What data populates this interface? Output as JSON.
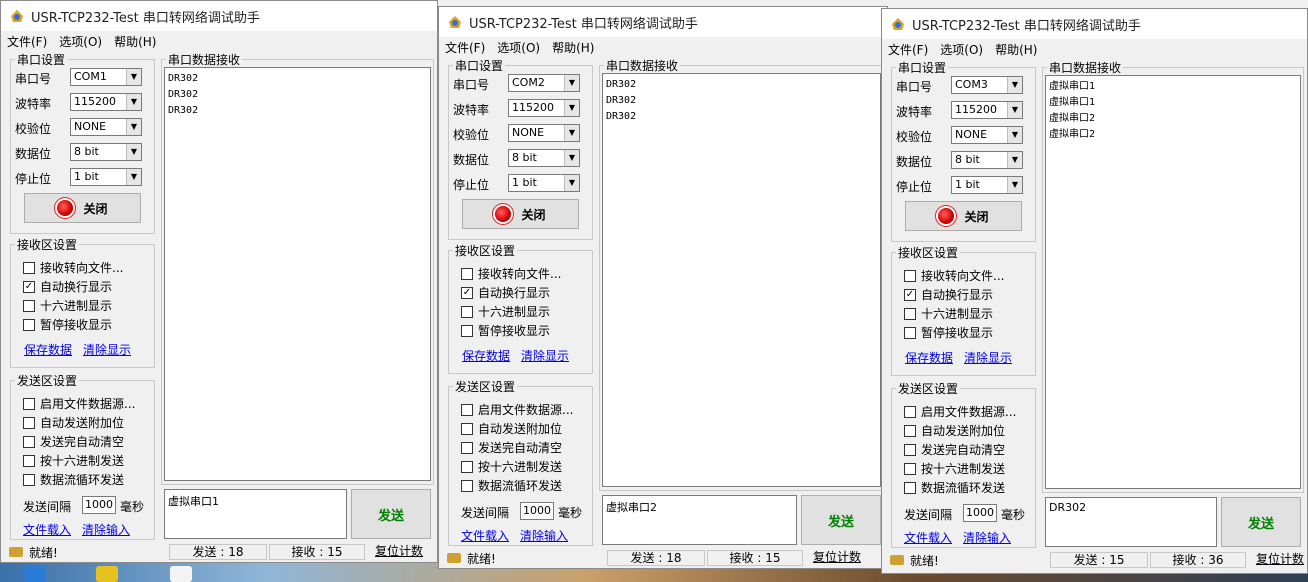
{
  "windows": [
    {
      "title": "USR-TCP232-Test 串口转网络调试助手",
      "menu": [
        "文件(F)",
        "选项(O)",
        "帮助(H)"
      ],
      "serial_group": "串口设置",
      "port_label": "串口号",
      "port": "COM1",
      "baud_label": "波特率",
      "baud": "115200",
      "parity_label": "校验位",
      "parity": "NONE",
      "databits_label": "数据位",
      "databits": "8 bit",
      "stopbits_label": "停止位",
      "stopbits": "1 bit",
      "close_label": "关闭",
      "recv_group": "接收区设置",
      "recv_opts": [
        {
          "label": "接收转向文件...",
          "checked": false
        },
        {
          "label": "自动换行显示",
          "checked": true
        },
        {
          "label": "十六进制显示",
          "checked": false
        },
        {
          "label": "暂停接收显示",
          "checked": false
        }
      ],
      "save_data": "保存数据",
      "clear_display": "清除显示",
      "send_group": "发送区设置",
      "send_opts": [
        {
          "label": "启用文件数据源...",
          "checked": false
        },
        {
          "label": "自动发送附加位",
          "checked": false
        },
        {
          "label": "发送完自动清空",
          "checked": false
        },
        {
          "label": "按十六进制发送",
          "checked": false
        },
        {
          "label": "数据流循环发送",
          "checked": false
        }
      ],
      "interval_label": "发送间隔",
      "interval": "1000",
      "interval_unit": "毫秒",
      "load_file": "文件载入",
      "clear_input": "清除输入",
      "recv_title": "串口数据接收",
      "recv_lines": [
        "DR302",
        "DR302",
        "DR302"
      ],
      "send_text": "虚拟串口1",
      "send_btn": "发送",
      "ready": "就绪!",
      "sent": "发送 : 18",
      "received": "接收 : 15",
      "reset": "复位计数"
    },
    {
      "title": "USR-TCP232-Test 串口转网络调试助手",
      "menu": [
        "文件(F)",
        "选项(O)",
        "帮助(H)"
      ],
      "serial_group": "串口设置",
      "port_label": "串口号",
      "port": "COM2",
      "baud_label": "波特率",
      "baud": "115200",
      "parity_label": "校验位",
      "parity": "NONE",
      "databits_label": "数据位",
      "databits": "8 bit",
      "stopbits_label": "停止位",
      "stopbits": "1 bit",
      "close_label": "关闭",
      "recv_group": "接收区设置",
      "recv_opts": [
        {
          "label": "接收转向文件...",
          "checked": false
        },
        {
          "label": "自动换行显示",
          "checked": true
        },
        {
          "label": "十六进制显示",
          "checked": false
        },
        {
          "label": "暂停接收显示",
          "checked": false
        }
      ],
      "save_data": "保存数据",
      "clear_display": "清除显示",
      "send_group": "发送区设置",
      "send_opts": [
        {
          "label": "启用文件数据源...",
          "checked": false
        },
        {
          "label": "自动发送附加位",
          "checked": false
        },
        {
          "label": "发送完自动清空",
          "checked": false
        },
        {
          "label": "按十六进制发送",
          "checked": false
        },
        {
          "label": "数据流循环发送",
          "checked": false
        }
      ],
      "interval_label": "发送间隔",
      "interval": "1000",
      "interval_unit": "毫秒",
      "load_file": "文件载入",
      "clear_input": "清除输入",
      "recv_title": "串口数据接收",
      "recv_lines": [
        "DR302",
        "DR302",
        "DR302"
      ],
      "send_text": "虚拟串口2",
      "send_btn": "发送",
      "ready": "就绪!",
      "sent": "发送 : 18",
      "received": "接收 : 15",
      "reset": "复位计数"
    },
    {
      "title": "USR-TCP232-Test 串口转网络调试助手",
      "menu": [
        "文件(F)",
        "选项(O)",
        "帮助(H)"
      ],
      "serial_group": "串口设置",
      "port_label": "串口号",
      "port": "COM3",
      "baud_label": "波特率",
      "baud": "115200",
      "parity_label": "校验位",
      "parity": "NONE",
      "databits_label": "数据位",
      "databits": "8 bit",
      "stopbits_label": "停止位",
      "stopbits": "1 bit",
      "close_label": "关闭",
      "recv_group": "接收区设置",
      "recv_opts": [
        {
          "label": "接收转向文件...",
          "checked": false
        },
        {
          "label": "自动换行显示",
          "checked": true
        },
        {
          "label": "十六进制显示",
          "checked": false
        },
        {
          "label": "暂停接收显示",
          "checked": false
        }
      ],
      "save_data": "保存数据",
      "clear_display": "清除显示",
      "send_group": "发送区设置",
      "send_opts": [
        {
          "label": "启用文件数据源...",
          "checked": false
        },
        {
          "label": "自动发送附加位",
          "checked": false
        },
        {
          "label": "发送完自动清空",
          "checked": false
        },
        {
          "label": "按十六进制发送",
          "checked": false
        },
        {
          "label": "数据流循环发送",
          "checked": false
        }
      ],
      "interval_label": "发送间隔",
      "interval": "1000",
      "interval_unit": "毫秒",
      "load_file": "文件载入",
      "clear_input": "清除输入",
      "recv_title": "串口数据接收",
      "recv_lines": [
        "虚拟串口1",
        "虚拟串口1",
        "虚拟串口2",
        "虚拟串口2"
      ],
      "send_text": "DR302",
      "send_btn": "发送",
      "ready": "就绪!",
      "sent": "发送 : 15",
      "received": "接收 : 36",
      "reset": "复位计数"
    }
  ],
  "colors": {
    "arrow": "#e8201a",
    "send_text": "#008000",
    "link": "#0000ee"
  }
}
